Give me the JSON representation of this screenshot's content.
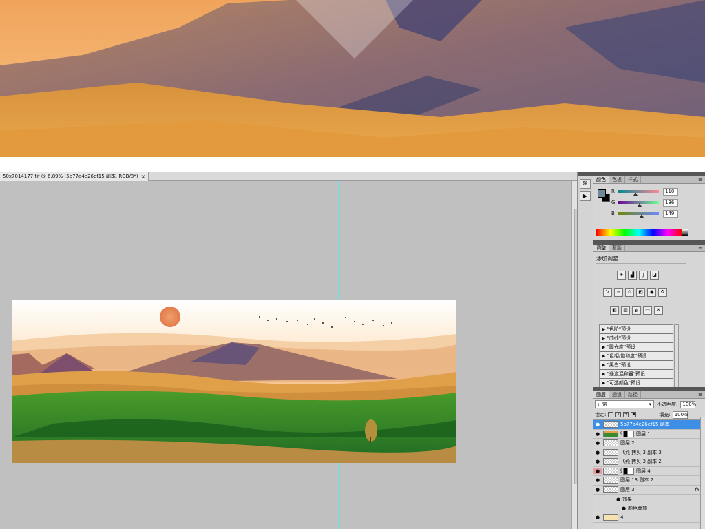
{
  "document": {
    "tab_label": "50x7014177.tif @ 6.89% (5b77a4e26ef15 副本, RGB/8*)",
    "close_glyph": "×"
  },
  "toolbar": {
    "buttons": [
      {
        "icon": "history-icon",
        "glyph": "⌘"
      },
      {
        "icon": "play-icon",
        "glyph": "▶"
      }
    ]
  },
  "color_panel": {
    "tabs": [
      "颜色",
      "色板",
      "样式"
    ],
    "menu_glyph": "≡",
    "foreground": "#6e8895",
    "background": "#000000",
    "channels": [
      {
        "label": "R",
        "value": "110",
        "fraction": 0.431
      },
      {
        "label": "G",
        "value": "136",
        "fraction": 0.533
      },
      {
        "label": "B",
        "value": "149",
        "fraction": 0.584
      }
    ]
  },
  "adjustments_panel": {
    "tabs": [
      "调整",
      "蒙版"
    ],
    "menu_glyph": "≡",
    "title": "添加调整",
    "icons_row1": [
      "brightness-icon",
      "levels-icon",
      "curves-icon",
      "exposure-icon"
    ],
    "icons_row2": [
      "vibrance-icon",
      "hue-saturation-icon",
      "color-balance-icon",
      "black-white-icon",
      "photo-filter-icon",
      "channel-mixer-icon"
    ],
    "icons_row3": [
      "invert-icon",
      "posterize-icon",
      "threshold-icon",
      "gradient-map-icon",
      "selective-color-icon"
    ],
    "presets": [
      "▶ \"色阶\"预设",
      "▶ \"曲线\"预设",
      "▶ \"曝光度\"预设",
      "▶ \"色相/饱和度\"预设",
      "▶ \"黑白\"预设",
      "▶ \"通道混和器\"预设",
      "▶ \"可选颜色\"预设"
    ]
  },
  "layers_panel": {
    "tabs": [
      "图层",
      "通道",
      "路径"
    ],
    "menu_glyph": "≡",
    "blend_mode": "正常",
    "opacity_label": "不透明度:",
    "opacity_value": "100%",
    "lock_label": "锁定:",
    "fill_label": "填充:",
    "fill_value": "100%",
    "layers": [
      {
        "name": "5b77a4e26ef15 副本",
        "selected": true
      },
      {
        "name": "图层 1"
      },
      {
        "name": "图层 2"
      },
      {
        "name": "飞燕 拷贝 3 副本 3"
      },
      {
        "name": "飞燕 拷贝 3 副本 2"
      },
      {
        "name": "图层 4"
      },
      {
        "name": "图层 13 副本 2"
      },
      {
        "name": "图层 3",
        "fx": "fx"
      },
      {
        "name": "效果",
        "sub": true
      },
      {
        "name": "颜色叠加",
        "sub": true
      },
      {
        "name": "4"
      }
    ]
  },
  "colors": {
    "guide": "#5fe6e6",
    "canvas_bg": "#c0c0c0",
    "selection": "#3d8ee6"
  }
}
